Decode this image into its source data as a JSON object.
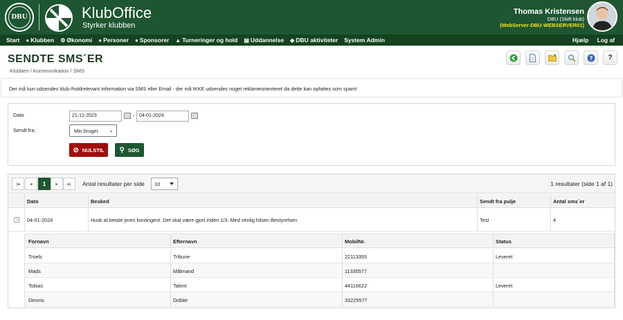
{
  "header": {
    "brand_title": "KlubOffice",
    "brand_subtitle": "Styrker klubben",
    "dbu_logo_text": "DBU",
    "user_name": "Thomas Kristensen",
    "user_club": "DBU (Skift klub)",
    "user_server": "(WebServer-DBU-WEBSERVER01)"
  },
  "nav": {
    "items": [
      {
        "label": "Start",
        "icon": ""
      },
      {
        "label": "Klubben",
        "icon": "users-icon"
      },
      {
        "label": "Økonomi",
        "icon": "cog-icon"
      },
      {
        "label": "Personer",
        "icon": "person-icon"
      },
      {
        "label": "Sponsorer",
        "icon": "people-icon"
      },
      {
        "label": "Turneringer og hold",
        "icon": "trophy-icon"
      },
      {
        "label": "Uddannelse",
        "icon": "book-icon"
      },
      {
        "label": "DBU aktiviteter",
        "icon": "cap-icon"
      },
      {
        "label": "System Admin",
        "icon": ""
      }
    ],
    "help": "Hjælp",
    "logout": "Log af"
  },
  "page": {
    "title": "SENDTE SMS´ER",
    "breadcrumb": "Klubben / Kommunikation / SMS"
  },
  "toolbar": [
    "back-icon",
    "document-icon",
    "folder-icon",
    "search-icon",
    "info-icon",
    "help-icon"
  ],
  "notice": "Der må kun udsendes klub-/holdrelevant information via SMS eller Email - der må IKKE udsendes noget reklameorienteret da dette kan opfattes som spam!",
  "filter": {
    "date_label": "Dato",
    "date_from": "21-12-2023",
    "date_sep": "-",
    "date_to": "04-01-2024",
    "sender_label": "Sendt fra:",
    "sender_value": "Min bruger",
    "reset_label": "NULSTIL",
    "search_label": "SØG"
  },
  "pager": {
    "first": "|◂",
    "prev": "◂",
    "current": "1",
    "next": "▸",
    "last": "▸|",
    "per_page_label": "Antal resultater per side",
    "per_page_value": "10",
    "results_text": "1 resultater (side 1 af 1)"
  },
  "table": {
    "columns": [
      "Dato",
      "Besked",
      "Sendt fra pulje",
      "Antal sms´er"
    ],
    "rows": [
      {
        "date": "04-01-2024",
        "message": "Husk at betale jeres kontingent. Det skal være gjort inden 1/3. Med venlig hilsen Bestyrelsen",
        "pool": "Test",
        "count": "4"
      }
    ]
  },
  "recipients": {
    "columns": [
      "Fornavn",
      "Efternavn",
      "MobilNr.",
      "Status"
    ],
    "rows": [
      {
        "first": "Troels",
        "last": "Tribune",
        "mobile": "22113355",
        "status": "Leveret"
      },
      {
        "first": "Mads",
        "last": "Målmand",
        "mobile": "11335577",
        "status": ""
      },
      {
        "first": "Tobias",
        "last": "Talent",
        "mobile": "44116622",
        "status": "Leveret"
      },
      {
        "first": "Dennis",
        "last": "Dribler",
        "mobile": "33225577",
        "status": ""
      }
    ]
  },
  "colors": {
    "brand_green": "#1e5631",
    "nav_green": "#14431f",
    "reset_red": "#9f0e0e",
    "server_yellow": "#f5e21b"
  }
}
